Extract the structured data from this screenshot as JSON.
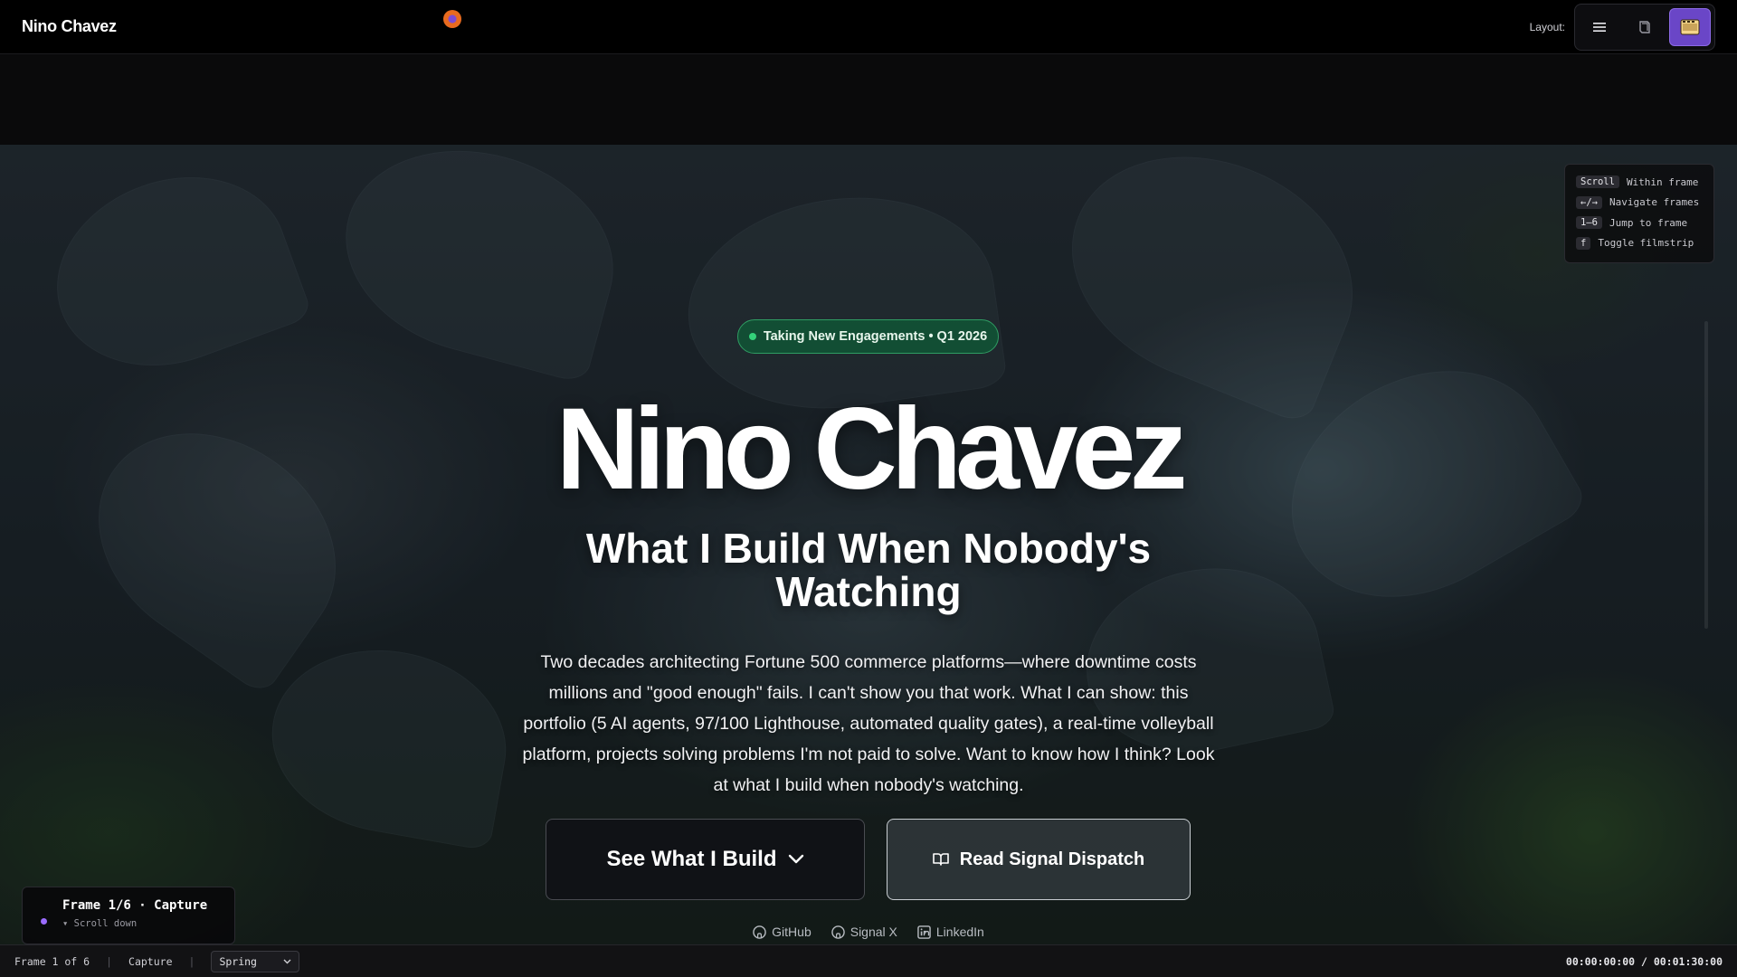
{
  "header": {
    "brand": "Nino Chavez",
    "layout_label": "Layout:",
    "layout_options": [
      "list-icon",
      "book-icon",
      "filmstrip-icon"
    ],
    "active_layout": "filmstrip-icon",
    "accent": "#6a46c7"
  },
  "shortcuts": [
    {
      "key": "Scroll",
      "action": "Within frame"
    },
    {
      "key": "←/→",
      "action": "Navigate frames"
    },
    {
      "key": "1–6",
      "action": "Jump to frame"
    },
    {
      "key": "f",
      "action": "Toggle filmstrip"
    }
  ],
  "hero": {
    "badge": "Taking New Engagements • Q1 2026",
    "title": "Nino Chavez",
    "subtitle": "What I Build When Nobody's Watching",
    "description": "Two decades architecting Fortune 500 commerce platforms—where downtime costs millions and \"good enough\" fails. I can't show you that work. What I can show: this portfolio (5 AI agents, 97/100 Lighthouse, automated quality gates), a real-time volleyball platform, projects solving problems I'm not paid to solve. Want to know how I think? Look at what I build when nobody's watching.",
    "primary_cta": "See What I Build",
    "secondary_cta": "Read Signal Dispatch",
    "social": [
      "GitHub",
      "Signal X",
      "LinkedIn"
    ]
  },
  "frame_card": {
    "title": "Frame 1/6 · Capture",
    "hint": "▾ Scroll down"
  },
  "footer": {
    "frame_counter": "Frame 1 of 6",
    "frame_name": "Capture",
    "preset": "Spring",
    "timecode": "00:00:00:00 / 00:01:30:00"
  }
}
